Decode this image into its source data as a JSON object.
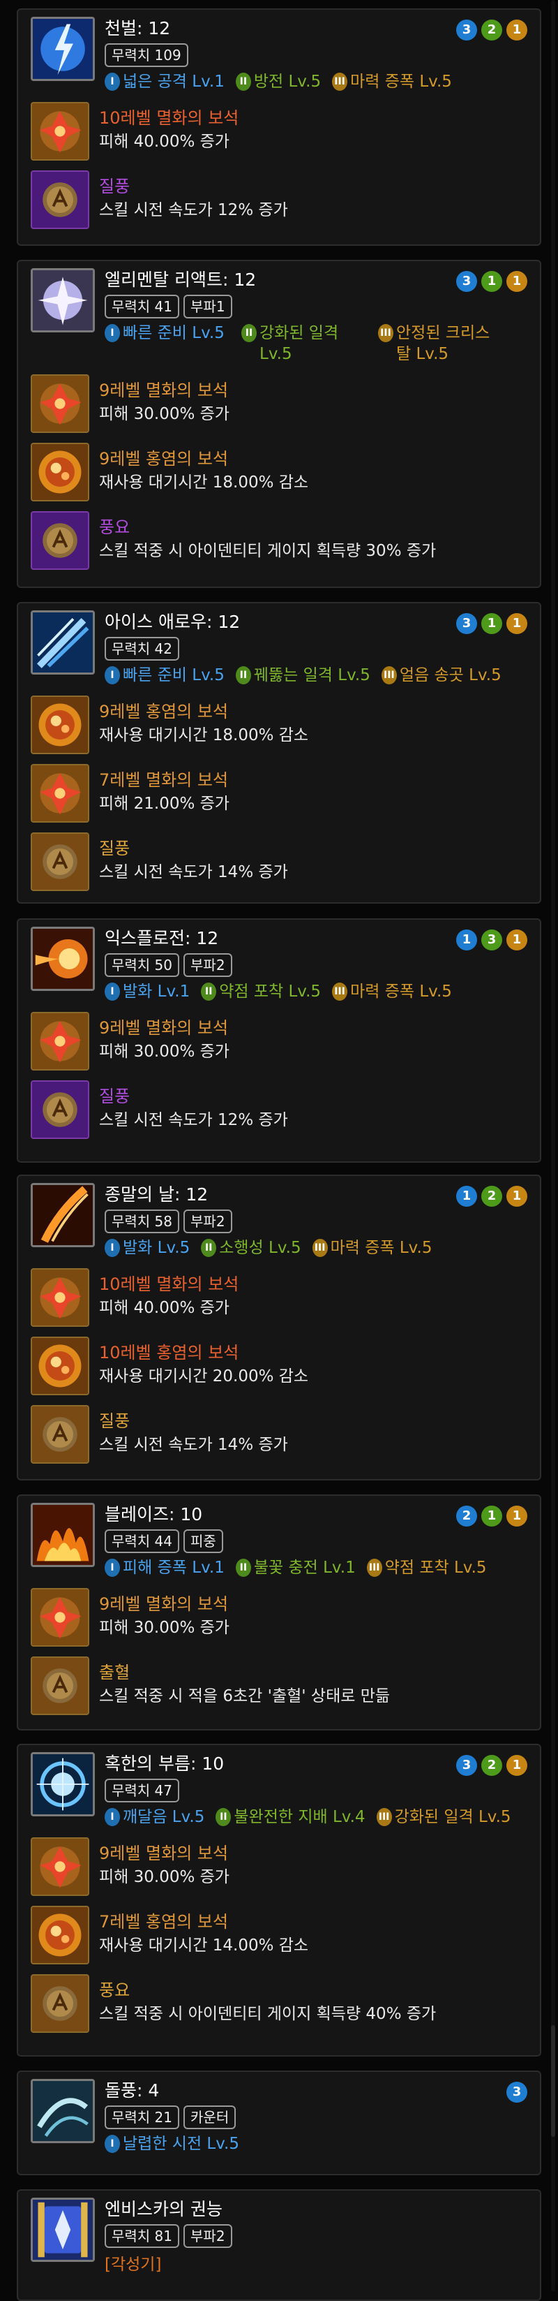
{
  "skills": [
    {
      "title": "천벌: 12",
      "badges": [
        "무력치 109"
      ],
      "tripods": [
        {
          "tier": "I",
          "name": "넓은 공격 Lv.1",
          "color": "blue"
        },
        {
          "tier": "II",
          "name": "방전 Lv.5",
          "color": "green"
        },
        {
          "tier": "III",
          "name": "마력 증폭 Lv.5",
          "color": "orange"
        }
      ],
      "levels": [
        {
          "n": "3",
          "c": "blue"
        },
        {
          "n": "2",
          "c": "green"
        },
        {
          "n": "1",
          "c": "orange"
        }
      ],
      "gems": [
        {
          "name": "10레벨 멸화의 보석",
          "desc": "피해 40.00% 증가",
          "nameColor": "red",
          "icon": "gem-fire-small"
        },
        {
          "name": "질풍",
          "desc": "스킬 시전 속도가 12% 증가",
          "nameColor": "purple",
          "icon": "rune-purple"
        }
      ]
    },
    {
      "title": "엘리멘탈 리액트: 12",
      "badges": [
        "무력치 41",
        "부파1"
      ],
      "tripods": [
        {
          "tier": "I",
          "name": "빠른 준비 Lv.5",
          "color": "blue"
        },
        {
          "tier": "II",
          "name": "강화된 일격 Lv.5",
          "color": "green"
        },
        {
          "tier": "III",
          "name": "안정된 크리스탈 Lv.5",
          "color": "orange"
        }
      ],
      "levels": [
        {
          "n": "3",
          "c": "blue"
        },
        {
          "n": "1",
          "c": "green"
        },
        {
          "n": "1",
          "c": "orange"
        }
      ],
      "gems": [
        {
          "name": "9레벨 멸화의 보석",
          "desc": "피해 30.00% 증가",
          "nameColor": "orange",
          "icon": "gem-fire-small"
        },
        {
          "name": "9레벨 홍염의 보석",
          "desc": "재사용 대기시간 18.00% 감소",
          "nameColor": "orange",
          "icon": "gem-flame-big"
        },
        {
          "name": "풍요",
          "desc": "스킬 적중 시 아이덴티티 게이지 획득량 30% 증가",
          "nameColor": "purple",
          "icon": "rune-purple"
        }
      ]
    },
    {
      "title": "아이스 애로우: 12",
      "badges": [
        "무력치 42"
      ],
      "tripods": [
        {
          "tier": "I",
          "name": "빠른 준비 Lv.5",
          "color": "blue"
        },
        {
          "tier": "II",
          "name": "꿰뚫는 일격 Lv.5",
          "color": "green"
        },
        {
          "tier": "III",
          "name": "얼음 송곳 Lv.5",
          "color": "orange"
        }
      ],
      "levels": [
        {
          "n": "3",
          "c": "blue"
        },
        {
          "n": "1",
          "c": "green"
        },
        {
          "n": "1",
          "c": "orange"
        }
      ],
      "gems": [
        {
          "name": "9레벨 홍염의 보석",
          "desc": "재사용 대기시간 18.00% 감소",
          "nameColor": "orange",
          "icon": "gem-flame-big"
        },
        {
          "name": "7레벨 멸화의 보석",
          "desc": "피해 21.00% 증가",
          "nameColor": "orange",
          "icon": "gem-fire-small"
        },
        {
          "name": "질풍",
          "desc": "스킬 시전 속도가 14% 증가",
          "nameColor": "gold",
          "icon": "rune-gold"
        }
      ]
    },
    {
      "title": "익스플로전: 12",
      "badges": [
        "무력치 50",
        "부파2"
      ],
      "tripods": [
        {
          "tier": "I",
          "name": "발화 Lv.1",
          "color": "blue"
        },
        {
          "tier": "II",
          "name": "약점 포착 Lv.5",
          "color": "green"
        },
        {
          "tier": "III",
          "name": "마력 증폭 Lv.5",
          "color": "orange"
        }
      ],
      "levels": [
        {
          "n": "1",
          "c": "blue"
        },
        {
          "n": "3",
          "c": "green"
        },
        {
          "n": "1",
          "c": "orange"
        }
      ],
      "gems": [
        {
          "name": "9레벨 멸화의 보석",
          "desc": "피해 30.00% 증가",
          "nameColor": "orange",
          "icon": "gem-fire-small"
        },
        {
          "name": "질풍",
          "desc": "스킬 시전 속도가 12% 증가",
          "nameColor": "purple",
          "icon": "rune-purple"
        }
      ]
    },
    {
      "title": "종말의 날: 12",
      "badges": [
        "무력치 58",
        "부파2"
      ],
      "tripods": [
        {
          "tier": "I",
          "name": "발화 Lv.5",
          "color": "blue"
        },
        {
          "tier": "II",
          "name": "소행성 Lv.5",
          "color": "green"
        },
        {
          "tier": "III",
          "name": "마력 증폭 Lv.5",
          "color": "orange"
        }
      ],
      "levels": [
        {
          "n": "1",
          "c": "blue"
        },
        {
          "n": "2",
          "c": "green"
        },
        {
          "n": "1",
          "c": "orange"
        }
      ],
      "gems": [
        {
          "name": "10레벨 멸화의 보석",
          "desc": "피해 40.00% 증가",
          "nameColor": "red",
          "icon": "gem-fire-small"
        },
        {
          "name": "10레벨 홍염의 보석",
          "desc": "재사용 대기시간 20.00% 감소",
          "nameColor": "red",
          "icon": "gem-flame-big"
        },
        {
          "name": "질풍",
          "desc": "스킬 시전 속도가 14% 증가",
          "nameColor": "gold",
          "icon": "rune-gold"
        }
      ]
    },
    {
      "title": "블레이즈: 10",
      "badges": [
        "무력치 44",
        "피중"
      ],
      "tripods": [
        {
          "tier": "I",
          "name": "피해 증폭 Lv.1",
          "color": "blue"
        },
        {
          "tier": "II",
          "name": "불꽃 충전 Lv.1",
          "color": "green"
        },
        {
          "tier": "III",
          "name": "약점 포착 Lv.5",
          "color": "orange"
        }
      ],
      "levels": [
        {
          "n": "2",
          "c": "blue"
        },
        {
          "n": "1",
          "c": "green"
        },
        {
          "n": "1",
          "c": "orange"
        }
      ],
      "gems": [
        {
          "name": "9레벨 멸화의 보석",
          "desc": "피해 30.00% 증가",
          "nameColor": "orange",
          "icon": "gem-fire-small"
        },
        {
          "name": "출혈",
          "desc": "스킬 적중 시 적을 6초간 '출혈' 상태로 만듦",
          "nameColor": "gold",
          "icon": "rune-gold"
        }
      ]
    },
    {
      "title": "혹한의 부름: 10",
      "badges": [
        "무력치 47"
      ],
      "tripods": [
        {
          "tier": "I",
          "name": "깨달음 Lv.5",
          "color": "blue"
        },
        {
          "tier": "II",
          "name": "불완전한 지배 Lv.4",
          "color": "green"
        },
        {
          "tier": "III",
          "name": "강화된 일격 Lv.5",
          "color": "orange"
        }
      ],
      "levels": [
        {
          "n": "3",
          "c": "blue"
        },
        {
          "n": "2",
          "c": "green"
        },
        {
          "n": "1",
          "c": "orange"
        }
      ],
      "gems": [
        {
          "name": "9레벨 멸화의 보석",
          "desc": "피해 30.00% 증가",
          "nameColor": "orange",
          "icon": "gem-fire-small"
        },
        {
          "name": "7레벨 홍염의 보석",
          "desc": "재사용 대기시간 14.00% 감소",
          "nameColor": "orange",
          "icon": "gem-flame-big"
        },
        {
          "name": "풍요",
          "desc": "스킬 적중 시 아이덴티티 게이지 획득량 40% 증가",
          "nameColor": "gold",
          "icon": "rune-gold"
        }
      ]
    },
    {
      "title": "돌풍: 4",
      "badges": [
        "무력치 21",
        "카운터"
      ],
      "tripods": [
        {
          "tier": "I",
          "name": "날렵한 시전 Lv.5",
          "color": "blue"
        }
      ],
      "levels": [
        {
          "n": "3",
          "c": "blue"
        }
      ],
      "gems": []
    },
    {
      "title": "엔비스카의 권능",
      "badges": [
        "무력치 81",
        "부파2"
      ],
      "tripods": [],
      "levels": [],
      "gems": [],
      "awakening": "[각성기]"
    }
  ],
  "skillIcons": [
    "lightning-icon",
    "crystal-burst-icon",
    "ice-arrow-icon",
    "explosion-icon",
    "doomsday-icon",
    "blaze-icon",
    "frost-call-icon",
    "gust-icon",
    "envisca-icon"
  ]
}
